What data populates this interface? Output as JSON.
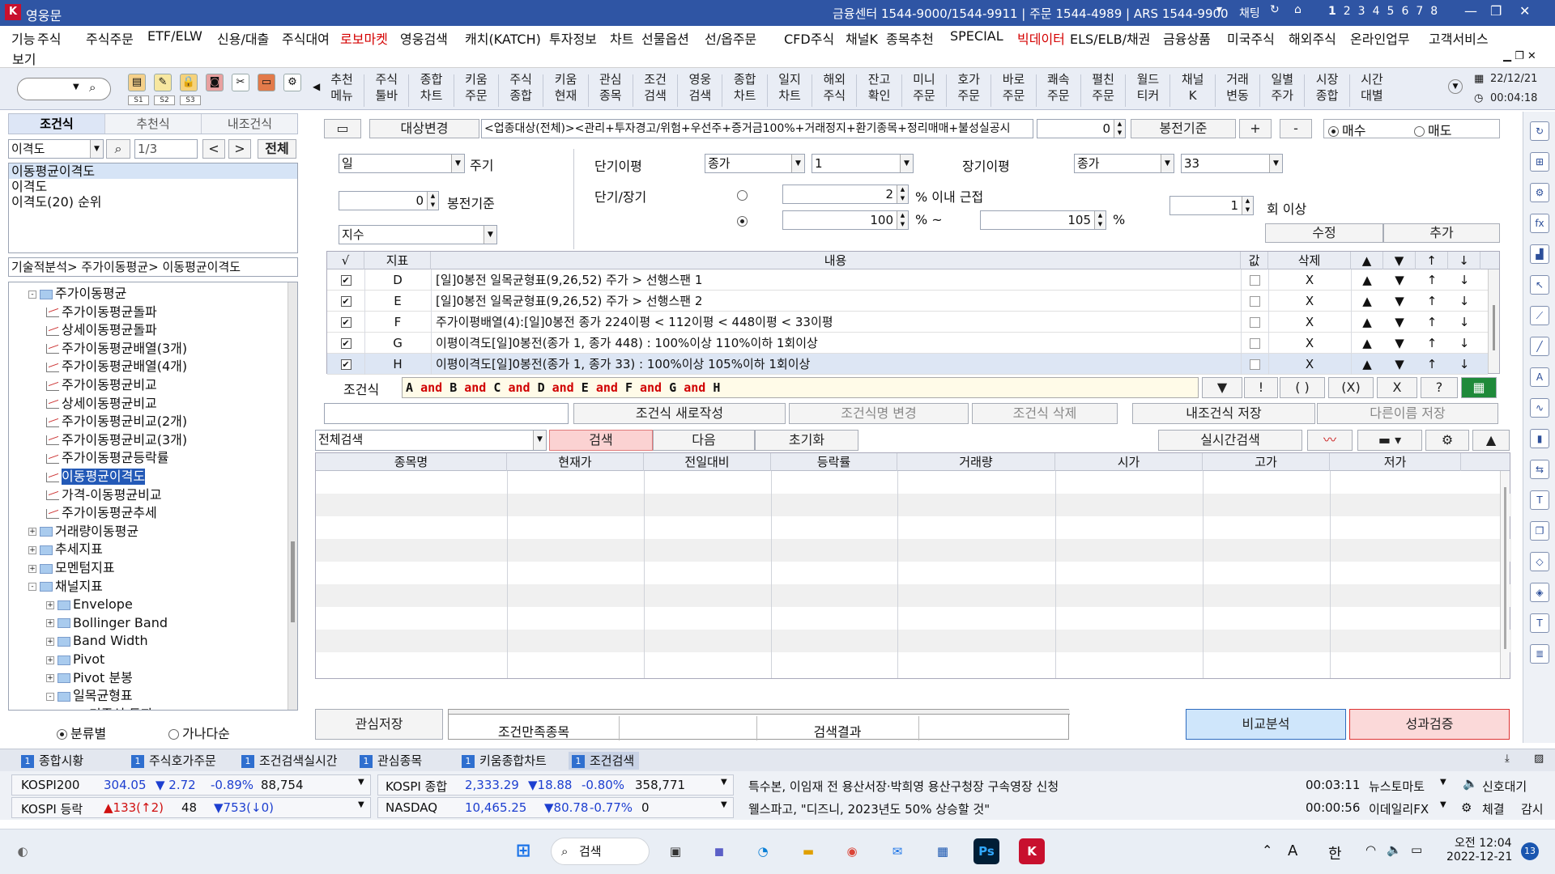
{
  "window": {
    "title": "영웅문",
    "info": "금융센터 1544-9000/1544-9911 | 주문 1544-4989 | ARS 1544-9900",
    "chat_label": "채팅",
    "pages": [
      "1",
      "2",
      "3",
      "4",
      "5",
      "6",
      "7",
      "8"
    ]
  },
  "menu": {
    "items": [
      "기능",
      "주식",
      "주식주문",
      "ETF/ELW",
      "신용/대출",
      "주식대여",
      "로보마켓",
      "영웅검색",
      "캐치(KATCH)",
      "투자정보",
      "차트",
      "선물옵션",
      "선/옵주문",
      "CFD주식",
      "채널K",
      "종목추천",
      "SPECIAL",
      "빅데이터",
      "ELS/ELB/채권",
      "금융상품",
      "미국주식",
      "해외주식",
      "온라인업무",
      "고객서비스"
    ],
    "red_items": [
      "로보마켓",
      "빅데이터"
    ],
    "second_line": "보기"
  },
  "toolbar": {
    "slots": [
      "S1",
      "S2",
      "S3"
    ],
    "groups": [
      [
        "추천",
        "메뉴"
      ],
      [
        "주식",
        "툴바"
      ],
      [
        "종합",
        "차트"
      ],
      [
        "키움",
        "주문"
      ],
      [
        "주식",
        "종합"
      ],
      [
        "키움",
        "현재"
      ],
      [
        "관심",
        "종목"
      ],
      [
        "조건",
        "검색"
      ],
      [
        "영웅",
        "검색"
      ],
      [
        "종합",
        "차트"
      ],
      [
        "일지",
        "차트"
      ],
      [
        "해외",
        "주식"
      ],
      [
        "잔고",
        "확인"
      ],
      [
        "미니",
        "주문"
      ],
      [
        "호가",
        "주문"
      ],
      [
        "바로",
        "주문"
      ],
      [
        "쾌속",
        "주문"
      ],
      [
        "펼친",
        "주문"
      ],
      [
        "월드",
        "티커"
      ],
      [
        "채널",
        "K"
      ],
      [
        "거래",
        "변동"
      ],
      [
        "일별",
        "주가"
      ],
      [
        "시장",
        "종합"
      ],
      [
        "시간",
        "대별"
      ]
    ],
    "date": "22/12/21",
    "time": "00:04:18"
  },
  "left": {
    "tabs": [
      "조건식",
      "추천식",
      "내조건식"
    ],
    "search_value": "이격도",
    "page_indicator": "1/3",
    "prev": "<",
    "next": ">",
    "all_btn": "전체",
    "results": [
      "이동평균이격도",
      "이격도",
      "이격도(20) 순위"
    ],
    "path": "기술적분석> 주가이동평균> 이동평균이격도",
    "tree": [
      {
        "level": 1,
        "type": "folder",
        "exp": "-",
        "label": "주가이동평균"
      },
      {
        "level": 2,
        "type": "chart",
        "label": "주가이동평균돌파"
      },
      {
        "level": 2,
        "type": "chart",
        "label": "상세이동평균돌파"
      },
      {
        "level": 2,
        "type": "chart",
        "label": "주가이동평균배열(3개)"
      },
      {
        "level": 2,
        "type": "chart",
        "label": "주가이동평균배열(4개)"
      },
      {
        "level": 2,
        "type": "chart",
        "label": "주가이동평균비교"
      },
      {
        "level": 2,
        "type": "chart",
        "label": "상세이동평균비교"
      },
      {
        "level": 2,
        "type": "chart",
        "label": "주가이동평균비교(2개)"
      },
      {
        "level": 2,
        "type": "chart",
        "label": "주가이동평균비교(3개)"
      },
      {
        "level": 2,
        "type": "chart",
        "label": "주가이동평균등락률"
      },
      {
        "level": 2,
        "type": "chart",
        "label": "이동평균이격도",
        "selected": true
      },
      {
        "level": 2,
        "type": "chart",
        "label": "가격-이동평균비교"
      },
      {
        "level": 2,
        "type": "chart",
        "label": "주가이동평균추세"
      },
      {
        "level": 1,
        "type": "folder",
        "exp": "+",
        "label": "거래량이동평균"
      },
      {
        "level": 1,
        "type": "folder",
        "exp": "+",
        "label": "추세지표"
      },
      {
        "level": 1,
        "type": "folder",
        "exp": "+",
        "label": "모멘텀지표"
      },
      {
        "level": 1,
        "type": "folder",
        "exp": "-",
        "label": "채널지표"
      },
      {
        "level": 2,
        "type": "folder",
        "exp": "+",
        "label": "Envelope"
      },
      {
        "level": 2,
        "type": "folder",
        "exp": "+",
        "label": "Bollinger Band"
      },
      {
        "level": 2,
        "type": "folder",
        "exp": "+",
        "label": "Band Width"
      },
      {
        "level": 2,
        "type": "folder",
        "exp": "+",
        "label": "Pivot"
      },
      {
        "level": 2,
        "type": "folder",
        "exp": "+",
        "label": "Pivot 분봉"
      },
      {
        "level": 2,
        "type": "folder",
        "exp": "-",
        "label": "일목균형표"
      },
      {
        "level": 3,
        "type": "chart",
        "label": "기준선 돌파"
      }
    ],
    "radio_a": "분류별",
    "radio_b": "가나다순"
  },
  "condition": {
    "target_btn": "대상변경",
    "target_text": "<업종대상(전체)><관리+투자경고/위험+우선주+증거금100%+거래정지+환기종목+정리매매+불성실공시",
    "target_num": "0",
    "bong_btn": "봉전기준",
    "plus": "+",
    "minus": "-",
    "buy": "매수",
    "sell": "매도",
    "period_value": "일",
    "period_label": "주기",
    "short_ma_label": "단기이평",
    "short_ma_type": "종가",
    "short_ma_val": "1",
    "long_ma_label": "장기이평",
    "long_ma_type": "종가",
    "long_ma_val": "33",
    "bong_value": "0",
    "bong_label": "봉전기준",
    "ratio_label": "단기/장기",
    "near_value": "2",
    "near_label": "% 이내 근접",
    "range_from": "100",
    "range_sep": "% ~",
    "range_to": "105",
    "range_pct": "%",
    "times_value": "1",
    "times_label": "회 이상",
    "index_value": "지수",
    "edit_btn": "수정",
    "add_btn": "추가",
    "grid_headers": [
      "√",
      "지표",
      "내용",
      "값",
      "삭제",
      "▲",
      "▼",
      "↑",
      "↓"
    ],
    "rows": [
      {
        "id": "D",
        "content": "[일]0봉전 일목균형표(9,26,52) 주가 > 선행스팬 1"
      },
      {
        "id": "E",
        "content": "[일]0봉전 일목균형표(9,26,52) 주가 > 선행스팬 2"
      },
      {
        "id": "F",
        "content": "주가이평배열(4):[일]0봉전 종가 224이평 < 112이평 < 448이평 < 33이평"
      },
      {
        "id": "G",
        "content": "이평이격도[일]0봉전(종가 1, 종가 448) : 100%이상 110%이하 1회이상"
      },
      {
        "id": "H",
        "content": "이평이격도[일]0봉전(종가 1, 종가 33) : 100%이상 105%이하 1회이상"
      }
    ],
    "del_label": "X",
    "formula_label": "조건식",
    "formula": [
      "A",
      "B",
      "C",
      "D",
      "E",
      "F",
      "G",
      "H"
    ],
    "and_word": "and",
    "formula_btns": [
      "▼",
      "!",
      "( )",
      "(X)",
      "X",
      "?"
    ],
    "new_btn": "조건식 새로작성",
    "rename_btn": "조건식명 변경",
    "delete_btn": "조건식 삭제",
    "save_btn": "내조건식 저장",
    "saveas_btn": "다른이름 저장"
  },
  "search": {
    "scope": "전체검색",
    "search_btn": "검색",
    "next_btn": "다음",
    "reset_btn": "초기화",
    "realtime_btn": "실시간검색",
    "up_btn": "▲",
    "columns": [
      "종목명",
      "현재가",
      "전일대비",
      "등락률",
      "거래량",
      "시가",
      "고가",
      "저가"
    ]
  },
  "bottom_actions": {
    "interest_btn": "관심저장",
    "tab1": "조건만족종목",
    "tab2": "검색결과",
    "compare_btn": "비교분석",
    "perf_btn": "성과검증"
  },
  "taskbar_tabs": [
    {
      "num": "1",
      "label": "종합시황"
    },
    {
      "num": "1",
      "label": "주식호가주문"
    },
    {
      "num": "1",
      "label": "조건검색실시간"
    },
    {
      "num": "1",
      "label": "관심종목"
    },
    {
      "num": "1",
      "label": "키움종합차트"
    },
    {
      "num": "1",
      "label": "조건검색",
      "active": true
    }
  ],
  "ticker": {
    "row1": {
      "name": "KOSPI200",
      "value": "304.05",
      "change": "▼ 2.72",
      "pct": "-0.89%",
      "vol": "88,754",
      "name2": "KOSPI 종합",
      "value2": "2,333.29",
      "change2": "▼18.88",
      "pct2": "-0.80%",
      "vol2": "358,771",
      "news": "특수본, 이임재 전 용산서장·박희영 용산구청장 구속영장 신청",
      "time": "00:03:11",
      "source": "뉴스토마토",
      "alert": "신호대기"
    },
    "row2": {
      "name": "KOSPI 등락",
      "up": "▲133(↑2)",
      "flat": "48",
      "down": "▼753(↓0)",
      "name2": "NASDAQ",
      "value2": "10,465.25",
      "change2": "▼80.78",
      "pct2": "-0.77%",
      "vol2": "0",
      "news": "웰스파고, \"디즈니, 2023년도 50% 상승할 것\"",
      "time": "00:00:56",
      "source": "이데일리FX",
      "btn1": "체결",
      "btn2": "감시"
    }
  },
  "windows_taskbar": {
    "search_label": "검색",
    "ampm": "오전 12:04",
    "date": "2022-12-21",
    "notif": "13",
    "lang_a": "A",
    "lang_b": "한"
  },
  "colors": {
    "titlebar": "#2f55a4",
    "accent_red": "#d40000",
    "selection": "#2359b7",
    "compare": "#cfe6fb",
    "perf": "#fbd9d9"
  }
}
